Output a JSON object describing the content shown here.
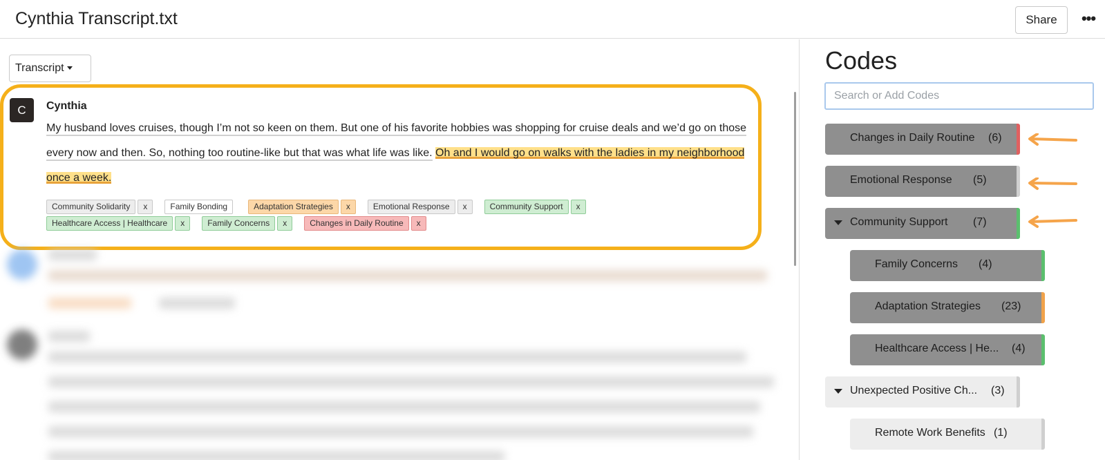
{
  "header": {
    "doc_title": "Cynthia Transcript.txt",
    "share_label": "Share",
    "more_label": "•••"
  },
  "main": {
    "view_dropdown_label": "Transcript",
    "utterance": {
      "avatar_letter": "C",
      "speaker": "Cynthia",
      "text_plain": "My husband loves cruises, though I’m not so keen on them. But one of his favorite hobbies was shopping for cruise deals and we’d go on those every now and then. So, nothing too routine-like but that was what life was like.",
      "text_highlighted": "Oh and I would go on walks with the ladies in my neighborhood once a week.",
      "tag_rows": [
        [
          {
            "label": "Community Solidarity",
            "color": "gray",
            "remove": "x"
          },
          {
            "label": "Family Bonding",
            "color": "white",
            "remove": ""
          },
          {
            "label": "Adaptation Strategies",
            "color": "orange",
            "remove": "x"
          },
          {
            "label": "Emotional Response",
            "color": "gray",
            "remove": "x"
          },
          {
            "label": "Community Support",
            "color": "green",
            "remove": "x"
          }
        ],
        [
          {
            "label": "Healthcare Access | Healthcare",
            "color": "green",
            "remove": "x"
          },
          {
            "label": "Family Concerns",
            "color": "green",
            "remove": "x"
          },
          {
            "label": "Changes in Daily Routine",
            "color": "red",
            "remove": "x"
          }
        ]
      ]
    }
  },
  "codes_panel": {
    "title": "Codes",
    "search_placeholder": "Search or Add Codes",
    "items": [
      {
        "label": "Changes in Daily Routine",
        "count": "(6)",
        "style": "dark",
        "bar_color": "#e06060",
        "expanded": false,
        "level": 0
      },
      {
        "label": "Emotional Response",
        "count": "(5)",
        "style": "dark",
        "bar_color": "#d0d0d0",
        "expanded": false,
        "level": 0
      },
      {
        "label": "Community Support",
        "count": "(7)",
        "style": "dark",
        "bar_color": "#5bbf6e",
        "expanded": true,
        "level": 0
      },
      {
        "label": "Family Concerns",
        "count": "(4)",
        "style": "dark",
        "bar_color": "#5bbf6e",
        "expanded": false,
        "level": 1
      },
      {
        "label": "Adaptation Strategies",
        "count": "(23)",
        "style": "dark",
        "bar_color": "#f0a24a",
        "expanded": false,
        "level": 1
      },
      {
        "label": "Healthcare Access | He...",
        "count": "(4)",
        "style": "dark",
        "bar_color": "#5bbf6e",
        "expanded": false,
        "level": 1
      },
      {
        "label": "Unexpected Positive Ch...",
        "count": "(3)",
        "style": "light",
        "bar_color": "#cfcfcf",
        "expanded": true,
        "level": 0
      },
      {
        "label": "Remote Work Benefits",
        "count": "(1)",
        "style": "light",
        "bar_color": "#cfcfcf",
        "expanded": false,
        "level": 1
      }
    ]
  },
  "colors": {
    "highlight_frame": "#f5b01a",
    "annotation_arrow": "#f5a44a"
  }
}
